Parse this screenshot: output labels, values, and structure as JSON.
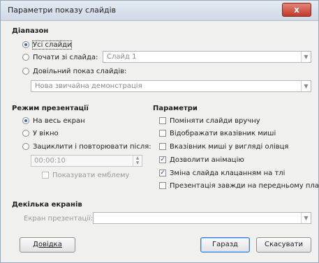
{
  "window": {
    "title": "Параметри показу слайдів",
    "close_glyph": "x"
  },
  "range": {
    "header": "Діапазон",
    "all_slides": "Усі слайди",
    "from_slide": "Почати зі слайда:",
    "from_slide_value": "Слайд 1",
    "custom_show": "Довільний показ слайдів:",
    "custom_show_value": "Нова звичайна демонстрація"
  },
  "mode": {
    "header": "Режим презентації",
    "full_screen": "На весь екран",
    "in_window": "У вікно",
    "loop": "Зациклити і повторювати після:",
    "loop_time": "00:00:10",
    "show_logo": "Показувати емблему"
  },
  "options": {
    "header": "Параметри",
    "items": [
      {
        "label": "Поміняти слайди вручну",
        "checked": false
      },
      {
        "label": "Відображати вказівник миші",
        "checked": false
      },
      {
        "label": "Вказівник миші у вигляді олівця",
        "checked": false
      },
      {
        "label": "Дозволити анімацію",
        "checked": true
      },
      {
        "label": "Зміна слайда клацанням на тлі",
        "checked": true
      },
      {
        "label": "Презентація завжди на передньому плані",
        "checked": false
      }
    ]
  },
  "monitors": {
    "header": "Декілька екранів",
    "screen_label": "Екран презентації:",
    "screen_value": ""
  },
  "buttons": {
    "help": "Довідка",
    "ok": "Гаразд",
    "cancel": "Скасувати"
  },
  "icons": {
    "close": "close-icon",
    "dropdown": "chevron-down-icon",
    "spin": "spin-arrows-icon",
    "check": "check-icon"
  },
  "colors": {
    "accent": "#2d6fc4",
    "close_button": "#c2392b",
    "default_button_border": "#3a7bd5"
  }
}
